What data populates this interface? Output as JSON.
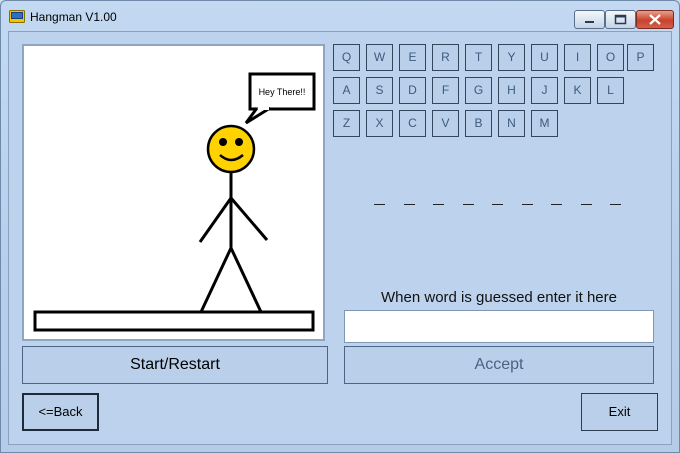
{
  "window": {
    "title": "Hangman V1.00",
    "controls": {
      "minimize": "minimize",
      "maximize": "maximize",
      "close": "close"
    }
  },
  "drawing": {
    "speech": "Hey There!!"
  },
  "keyboard": {
    "row1": [
      "Q",
      "W",
      "E",
      "R",
      "T",
      "Y",
      "U",
      "I",
      "O",
      "P"
    ],
    "row2": [
      "A",
      "S",
      "D",
      "F",
      "G",
      "H",
      "J",
      "K",
      "L"
    ],
    "row3": [
      "Z",
      "X",
      "C",
      "V",
      "B",
      "N",
      "M"
    ]
  },
  "word": {
    "blanks": 9
  },
  "guess": {
    "prompt": "When word is guessed enter it here",
    "value": ""
  },
  "buttons": {
    "start": "Start/Restart",
    "accept": "Accept",
    "back": "<=Back",
    "exit": "Exit"
  }
}
